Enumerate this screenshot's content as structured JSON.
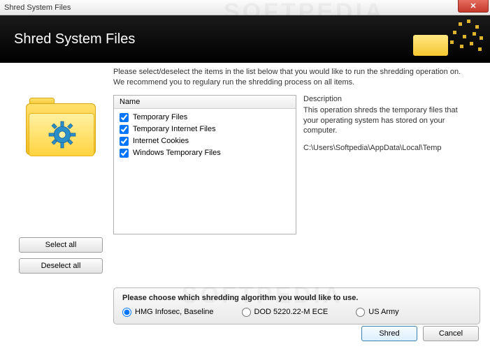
{
  "window": {
    "title": "Shred System Files"
  },
  "header": {
    "title": "Shred System Files"
  },
  "instruction": "Please select/deselect the items in the list below that you would like to run the shredding operation on. We recommend you to regulary run the shredding process on all items.",
  "list": {
    "header": "Name",
    "items": [
      {
        "label": "Temporary Files",
        "checked": true
      },
      {
        "label": "Temporary Internet Files",
        "checked": true
      },
      {
        "label": "Internet Cookies",
        "checked": true
      },
      {
        "label": "Windows Temporary Files",
        "checked": true
      }
    ]
  },
  "description": {
    "title": "Description",
    "body": "This operation shreds the temporary files that your operating system has stored on your computer.",
    "path": "C:\\Users\\Softpedia\\AppData\\Local\\Temp"
  },
  "buttons": {
    "select_all": "Select all",
    "deselect_all": "Deselect all",
    "shred": "Shred",
    "cancel": "Cancel"
  },
  "algorithm": {
    "title": "Please choose which shredding algorithm you would like to use.",
    "options": [
      {
        "label": "HMG Infosec, Baseline",
        "selected": true
      },
      {
        "label": "DOD 5220.22-M ECE",
        "selected": false
      },
      {
        "label": "US Army",
        "selected": false
      }
    ]
  },
  "watermark": "SOFTPEDIA"
}
